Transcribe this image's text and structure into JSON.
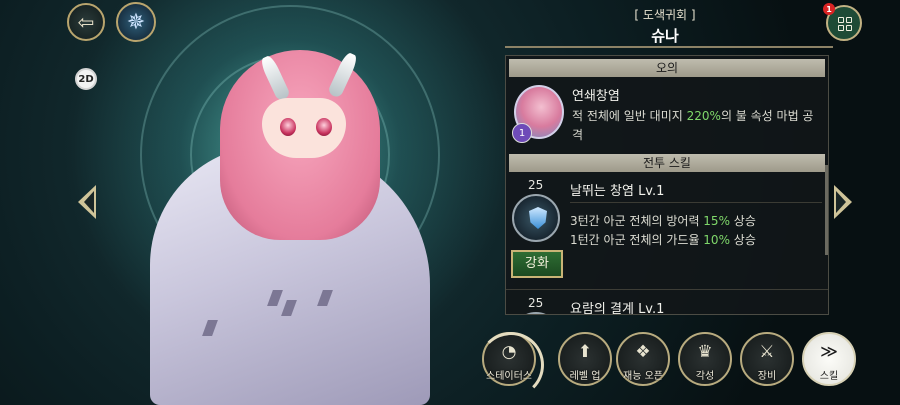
{
  "top": {
    "back_icon": "back-arrow-icon",
    "emblem_icon": "magic-circle-icon",
    "turn_badge": "2D"
  },
  "header": {
    "subtitle": "[ 도색귀회 ]",
    "name": "슈나"
  },
  "menu": {
    "notification_count": "1",
    "icon": "grid-menu-icon"
  },
  "ougi": {
    "section_title": "오의",
    "name": "연쇄창염",
    "badge": "1",
    "desc_prefix": "적 전체에 일반 대미지 ",
    "desc_value": "220%",
    "desc_suffix": "의 불 속성 마법 공격"
  },
  "battle_skill": {
    "section_title": "전투 스킬",
    "skills": [
      {
        "level_req": "25",
        "name": "날뛰는 창염 Lv.1",
        "line1_prefix": "3턴간 아군 전체의 방어력 ",
        "line1_value": "15%",
        "line1_suffix": " 상승",
        "line2_prefix": "1턴간 아군 전체의 가드율 ",
        "line2_value": "10%",
        "line2_suffix": " 상승",
        "upgrade_label": "강화"
      },
      {
        "level_req": "25",
        "name": "요람의 결계 Lv.1"
      }
    ]
  },
  "bottom_nav": [
    {
      "label": "스테이터스",
      "icon": "status-icon"
    },
    {
      "label": "레벨 업",
      "icon": "level-up-icon"
    },
    {
      "label": "재능 오픈",
      "icon": "talent-icon"
    },
    {
      "label": "각성",
      "icon": "awaken-icon"
    },
    {
      "label": "장비",
      "icon": "equipment-icon"
    },
    {
      "label": "스킬",
      "icon": "skill-icon"
    }
  ],
  "colors": {
    "highlight": "#7fd86a",
    "gold_border": "#b9a56e",
    "upgrade_green": "#2e6d33"
  }
}
